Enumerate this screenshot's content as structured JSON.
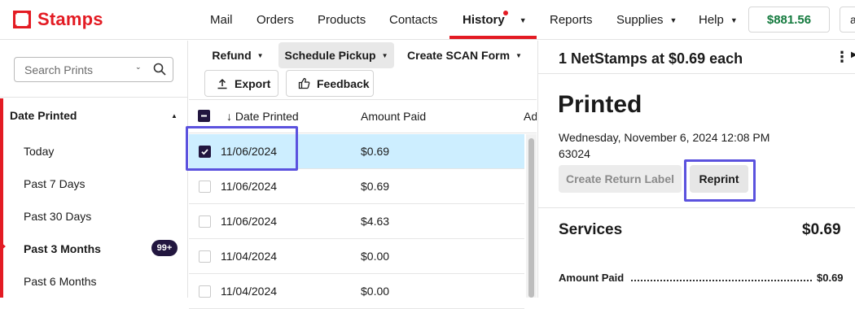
{
  "brand": {
    "name": "Stamps",
    "color": "#e31b23"
  },
  "nav": {
    "items": [
      {
        "label": "Mail"
      },
      {
        "label": "Orders"
      },
      {
        "label": "Products"
      },
      {
        "label": "Contacts"
      },
      {
        "label": "History",
        "active": true,
        "has_notification": true
      },
      {
        "label": "Reports"
      },
      {
        "label": "Supplies"
      },
      {
        "label": "Help"
      }
    ],
    "balance": "$881.56",
    "account_initial": "a"
  },
  "sidebar": {
    "search_placeholder": "Search Prints",
    "filter_title": "Date Printed",
    "filters": [
      {
        "label": "Today"
      },
      {
        "label": "Past 7 Days"
      },
      {
        "label": "Past 30 Days"
      },
      {
        "label": "Past 3 Months",
        "selected": true,
        "badge": "99+"
      },
      {
        "label": "Past 6 Months"
      }
    ]
  },
  "toolbar": {
    "refund": "Refund",
    "schedule_pickup": "Schedule Pickup",
    "create_scan": "Create SCAN Form",
    "export": "Export",
    "feedback": "Feedback"
  },
  "table": {
    "columns": [
      "↓ Date Printed",
      "Amount Paid",
      "Ad"
    ],
    "rows": [
      {
        "date": "11/06/2024",
        "amount": "$0.69",
        "selected": true
      },
      {
        "date": "11/06/2024",
        "amount": "$0.69"
      },
      {
        "date": "11/06/2024",
        "amount": "$4.63"
      },
      {
        "date": "11/04/2024",
        "amount": "$0.00"
      },
      {
        "date": "11/04/2024",
        "amount": "$0.00"
      }
    ]
  },
  "detail": {
    "title": "1 NetStamps at $0.69 each",
    "status": "Printed",
    "datetime": "Wednesday, November 6, 2024 12:08 PM",
    "zip": "63024",
    "create_return_label": "Create Return Label",
    "reprint": "Reprint",
    "services_label": "Services",
    "services_total": "$0.69",
    "amount_paid_label": "Amount Paid",
    "amount_paid_value": "$0.69"
  },
  "colors": {
    "accent": "#e31b23",
    "highlight": "#5b52de",
    "selected_row": "#cdeeff",
    "balance": "#147a3e",
    "badge": "#22163f"
  }
}
